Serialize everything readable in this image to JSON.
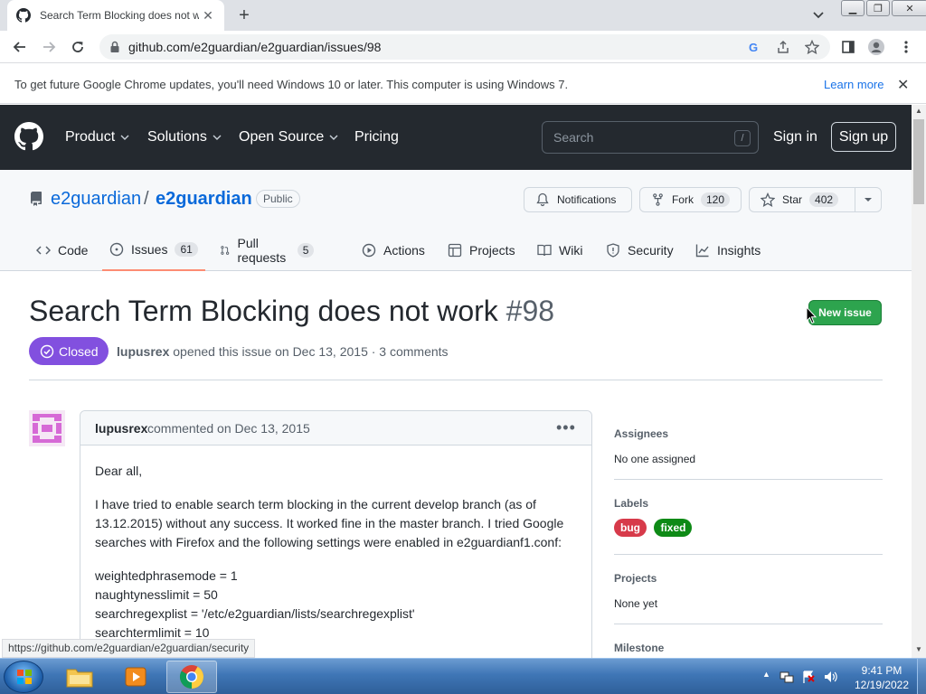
{
  "browser": {
    "tab_title": "Search Term Blocking does not w",
    "url": "github.com/e2guardian/e2guardian/issues/98",
    "infobar_message": "To get future Google Chrome updates, you'll need Windows 10 or later. This computer is using Windows 7.",
    "infobar_link": "Learn more",
    "status_url": "https://github.com/e2guardian/e2guardian/security"
  },
  "gh_header": {
    "nav": [
      "Product",
      "Solutions",
      "Open Source",
      "Pricing"
    ],
    "search_placeholder": "Search",
    "search_key": "/",
    "sign_in": "Sign in",
    "sign_up": "Sign up"
  },
  "repo": {
    "owner": "e2guardian",
    "separator": "/",
    "name": "e2guardian",
    "visibility": "Public",
    "notifications": "Notifications",
    "fork_label": "Fork",
    "fork_count": "120",
    "star_label": "Star",
    "star_count": "402",
    "tabs": [
      {
        "label": "Code",
        "count": ""
      },
      {
        "label": "Issues",
        "count": "61"
      },
      {
        "label": "Pull requests",
        "count": "5"
      },
      {
        "label": "Actions",
        "count": ""
      },
      {
        "label": "Projects",
        "count": ""
      },
      {
        "label": "Wiki",
        "count": ""
      },
      {
        "label": "Security",
        "count": ""
      },
      {
        "label": "Insights",
        "count": ""
      }
    ]
  },
  "issue": {
    "title": "Search Term Blocking does not work",
    "number": "#98",
    "new_issue": "New issue",
    "state": "Closed",
    "author": "lupusrex",
    "meta": "opened this issue on Dec 13, 2015 · 3 comments"
  },
  "comment": {
    "author": "lupusrex",
    "date": "commented on Dec 13, 2015",
    "para1": "Dear all,",
    "para2": "I have tried to enable search term blocking in the current develop branch (as of 13.12.2015) without any success. It worked fine in the master branch. I tried Google searches with Firefox and the following settings were enabled in e2guardianf1.conf:",
    "config": [
      "weightedphrasemode = 1",
      "naughtynesslimit = 50",
      "searchregexplist = '/etc/e2guardian/lists/searchregexplist'",
      "searchtermlimit = 10"
    ]
  },
  "sidebar": {
    "assignees_label": "Assignees",
    "assignees_value": "No one assigned",
    "labels_label": "Labels",
    "labels": [
      {
        "name": "bug",
        "color": "#d73a4a"
      },
      {
        "name": "fixed",
        "color": "#0e8a16"
      }
    ],
    "projects_label": "Projects",
    "projects_value": "None yet",
    "milestone_label": "Milestone"
  },
  "taskbar": {
    "time": "9:41 PM",
    "date": "12/19/2022"
  },
  "colors": {
    "accent": "#0969da",
    "closed": "#8250df",
    "new_issue": "#2da44e",
    "header": "#24292f"
  }
}
